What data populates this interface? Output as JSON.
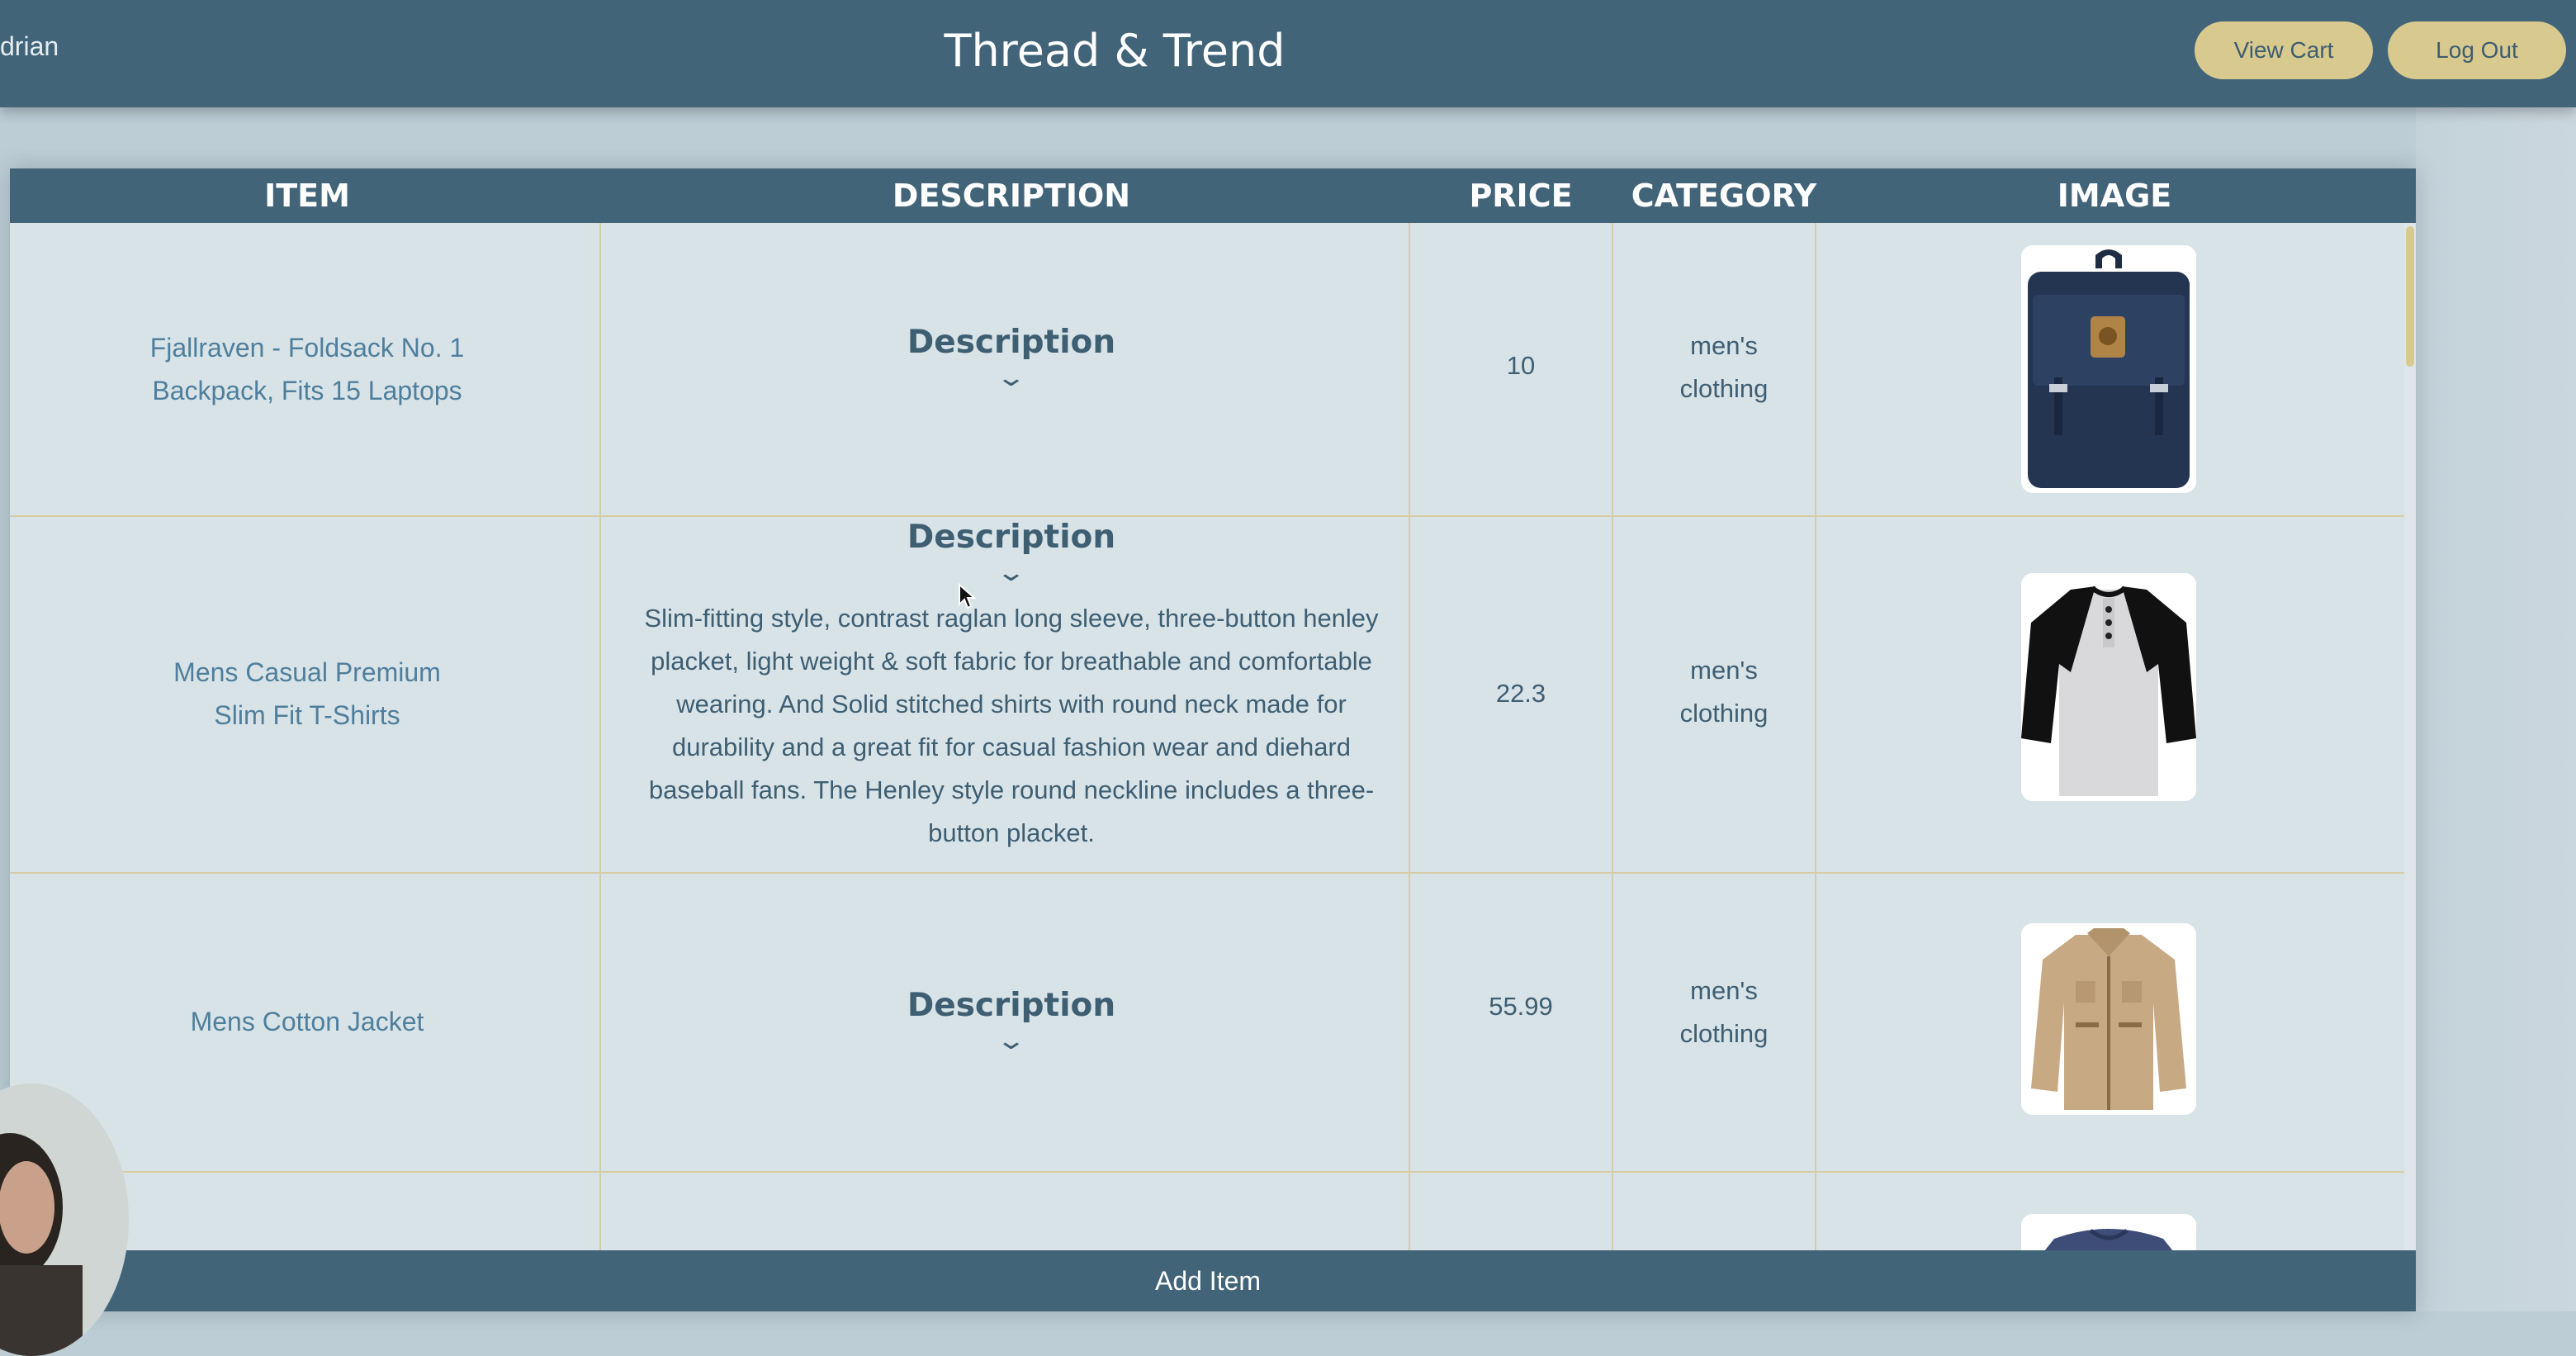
{
  "header": {
    "user": "drian",
    "title": "Thread & Trend",
    "view_cart": "View Cart",
    "log_out": "Log Out"
  },
  "table": {
    "columns": [
      "ITEM",
      "DESCRIPTION",
      "PRICE",
      "CATEGORY",
      "IMAGE"
    ],
    "rows": [
      {
        "item": "Fjallraven - Foldsack No. 1 Backpack, Fits 15 Laptops",
        "description_label": "Description",
        "description": "",
        "price": "10",
        "category": "men's clothing",
        "image_icon": "backpack-image"
      },
      {
        "item": "Mens Casual Premium Slim Fit T-Shirts",
        "description_label": "Description",
        "description": "Slim-fitting style, contrast raglan long sleeve, three-button henley placket, light weight & soft fabric for breathable and comfortable wearing. And Solid stitched shirts with round neck made for durability and a great fit for casual fashion wear and diehard baseball fans. The Henley style round neckline includes a three-button placket.",
        "price": "22.3",
        "category": "men's clothing",
        "image_icon": "tshirt-image"
      },
      {
        "item": "Mens Cotton Jacket",
        "description_label": "Description",
        "description": "",
        "price": "55.99",
        "category": "men's clothing",
        "image_icon": "jacket-image"
      }
    ]
  },
  "footer": {
    "add_item": "Add Item"
  },
  "colors": {
    "header_bg": "#426479",
    "accent_button": "#d8c98f",
    "table_bg": "#d8e3e8",
    "grid_line": "#d6cda6",
    "item_text": "#4f7f9c"
  }
}
